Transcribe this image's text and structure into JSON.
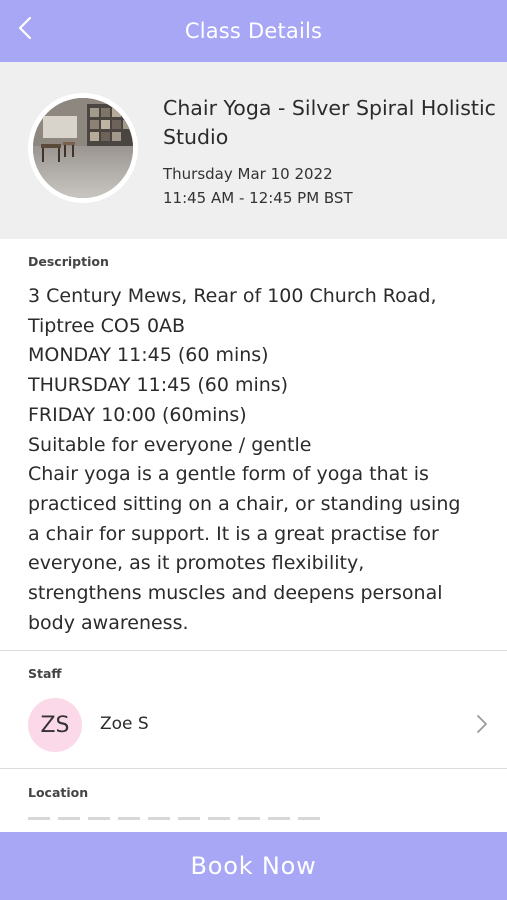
{
  "header": {
    "title": "Class Details",
    "back_icon": "chevron-left-icon"
  },
  "class": {
    "photo": "studio-photo",
    "name": "Chair Yoga - Silver Spiral Holistic Studio",
    "name_lines": [
      "Chair Yoga - Silver Spiral Holistic",
      "Studio"
    ],
    "date": "Thursday Mar 10 2022",
    "time": "11:45 AM - 12:45 PM BST"
  },
  "description": {
    "label": "Description",
    "lines": [
      "3 Century Mews, Rear of 100 Church Road,",
      "Tiptree CO5 0AB",
      "MONDAY 11:45 (60 mins)",
      "THURSDAY 11:45 (60 mins)",
      "FRIDAY 10:00 (60mins)",
      "Suitable for everyone / gentle",
      "Chair yoga is a gentle form of yoga that is",
      "practiced sitting on a chair, or standing using",
      "a chair for support. It is a great practise for",
      "everyone, as it promotes flexibility,",
      "strengthens muscles and deepens personal",
      "body awareness."
    ]
  },
  "staff": {
    "label": "Staff",
    "initials": "ZS",
    "name": "Zoe S",
    "avatar_color": "#fbd9e9",
    "chevron_icon": "chevron-right-icon"
  },
  "location": {
    "label": "Location"
  },
  "book_button": {
    "label": "Book Now"
  },
  "colors": {
    "accent": "#a7a7f6",
    "summary_background": "#efefef"
  }
}
